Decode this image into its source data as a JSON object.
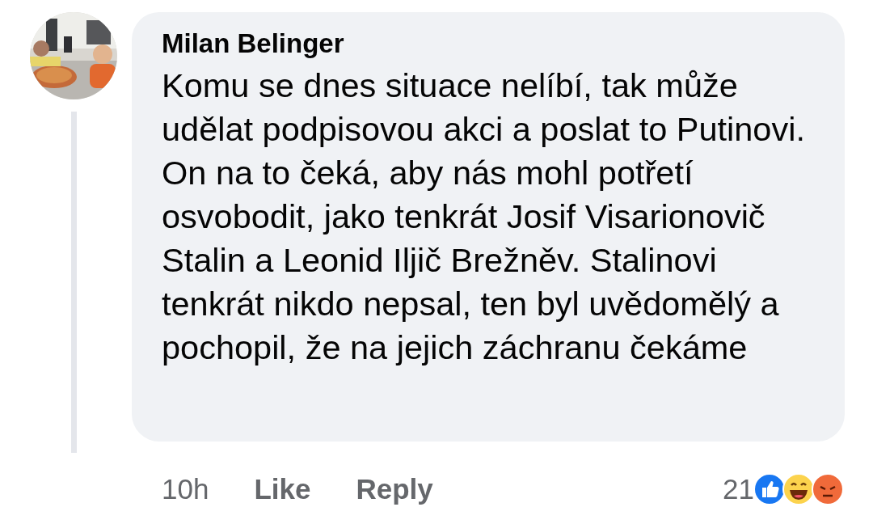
{
  "comment": {
    "author": "Milan Belinger",
    "text": "Komu se dnes situace nelíbí, tak může udělat podpisovou akci a poslat to Putinovi. On na to čeká, aby nás mohl potřetí osvobodit, jako tenkrát Josif Visarionovič Stalin a Leonid Iljič Brežněv. Stalinovi tenkrát nikdo nepsal, ten byl uvědomělý a pochopil, že na jejich záchranu čekáme",
    "time": "10h",
    "actions": [
      "Like",
      "Reply"
    ],
    "reaction_count": "21"
  }
}
